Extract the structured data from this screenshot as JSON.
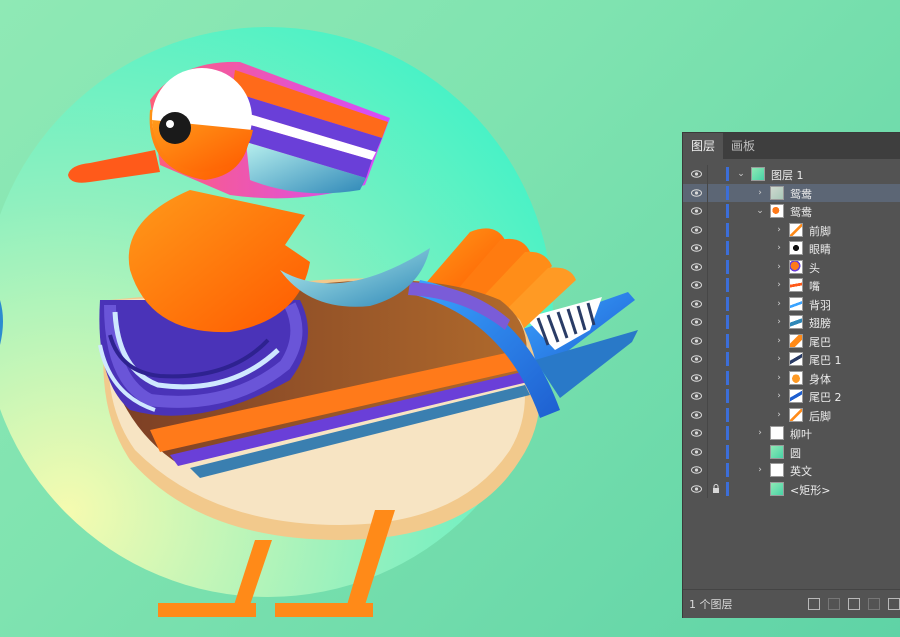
{
  "panel": {
    "tabs": [
      {
        "label": "图层",
        "active": true
      },
      {
        "label": "画板",
        "active": false
      }
    ],
    "layers": [
      {
        "name": "图层 1",
        "depth": 0,
        "expanded": true,
        "selected": false,
        "locked": false,
        "thumb": "layer-group"
      },
      {
        "name": "鸳鸯",
        "depth": 1,
        "expanded": false,
        "selected": true,
        "locked": false,
        "thumb": "duck-faded"
      },
      {
        "name": "鸳鸯",
        "depth": 1,
        "expanded": true,
        "selected": false,
        "locked": false,
        "thumb": "duck"
      },
      {
        "name": "前脚",
        "depth": 2,
        "expanded": false,
        "selected": false,
        "locked": false,
        "thumb": "leg"
      },
      {
        "name": "眼睛",
        "depth": 2,
        "expanded": false,
        "selected": false,
        "locked": false,
        "thumb": "eye"
      },
      {
        "name": "头",
        "depth": 2,
        "expanded": false,
        "selected": false,
        "locked": false,
        "thumb": "head"
      },
      {
        "name": "嘴",
        "depth": 2,
        "expanded": false,
        "selected": false,
        "locked": false,
        "thumb": "beak"
      },
      {
        "name": "背羽",
        "depth": 2,
        "expanded": false,
        "selected": false,
        "locked": false,
        "thumb": "back-feather"
      },
      {
        "name": "翅膀",
        "depth": 2,
        "expanded": false,
        "selected": false,
        "locked": false,
        "thumb": "wing"
      },
      {
        "name": "尾巴",
        "depth": 2,
        "expanded": false,
        "selected": false,
        "locked": false,
        "thumb": "tail"
      },
      {
        "name": "尾巴 1",
        "depth": 2,
        "expanded": false,
        "selected": false,
        "locked": false,
        "thumb": "tail1"
      },
      {
        "name": "身体",
        "depth": 2,
        "expanded": false,
        "selected": false,
        "locked": false,
        "thumb": "body"
      },
      {
        "name": "尾巴 2",
        "depth": 2,
        "expanded": false,
        "selected": false,
        "locked": false,
        "thumb": "tail2"
      },
      {
        "name": "后脚",
        "depth": 2,
        "expanded": false,
        "selected": false,
        "locked": false,
        "thumb": "leg"
      },
      {
        "name": "柳叶",
        "depth": 1,
        "expanded": false,
        "selected": false,
        "locked": false,
        "thumb": "white"
      },
      {
        "name": "圆",
        "depth": 1,
        "expanded": null,
        "selected": false,
        "locked": false,
        "thumb": "green"
      },
      {
        "name": "英文",
        "depth": 1,
        "expanded": false,
        "selected": false,
        "locked": false,
        "thumb": "white"
      },
      {
        "name": "<矩形>",
        "depth": 1,
        "expanded": null,
        "selected": false,
        "locked": true,
        "thumb": "green"
      }
    ],
    "footer": {
      "count_label": "1 个图层",
      "icons": [
        "export-icon",
        "search-icon",
        "make-clipping-mask-icon",
        "new-sublayer-icon",
        "new-layer-icon"
      ]
    }
  },
  "colors": {
    "background": "#7fe3b0",
    "panel": "#535353",
    "panel_dark": "#3e3e3e",
    "selection": "#5c6675",
    "layer_accent": "#3c6ed8",
    "duck_orange": "#ff7a00",
    "duck_purple": "#5a3fd0",
    "duck_brown": "#8a4b2a"
  }
}
